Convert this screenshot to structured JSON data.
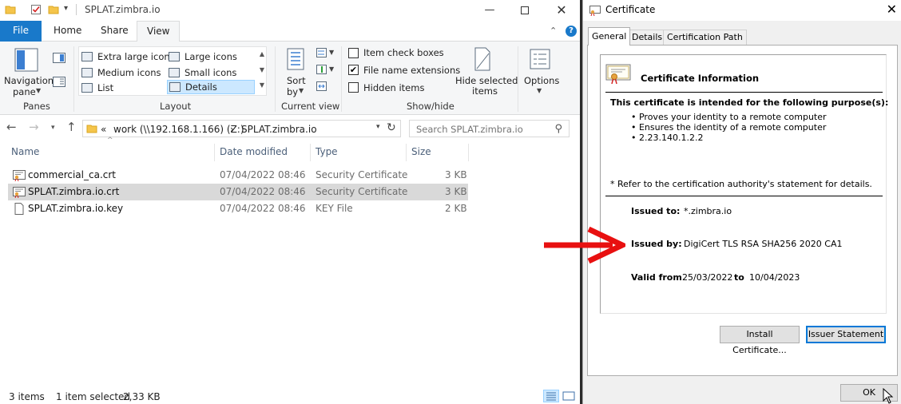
{
  "explorer": {
    "title": "SPLAT.zimbra.io",
    "tabs": {
      "file": "File",
      "home": "Home",
      "share": "Share",
      "view": "View"
    },
    "ribbon": {
      "panes": {
        "nav_pane": "Navigation",
        "nav_pane2": "pane",
        "group": "Panes"
      },
      "layout": {
        "items": [
          "Extra large icons",
          "Large icons",
          "Medium icons",
          "Small icons",
          "List",
          "Details"
        ],
        "selected": "Details",
        "group": "Layout"
      },
      "current_view": {
        "sort": "Sort",
        "sort2": "by",
        "group": "Current view"
      },
      "show_hide": {
        "item_check_boxes": "Item check boxes",
        "file_name_extensions": "File name extensions",
        "hidden_items": "Hidden items",
        "hide_selected": "Hide selected",
        "hide_selected2": "items",
        "group": "Show/hide"
      },
      "options": "Options"
    },
    "address": {
      "chevron": "«",
      "part1": "work (\\\\192.168.1.166) (Z:)",
      "sep": "›",
      "part2": "SPLAT.zimbra.io"
    },
    "search": {
      "placeholder": "Search SPLAT.zimbra.io"
    },
    "columns": {
      "name": "Name",
      "date": "Date modified",
      "type": "Type",
      "size": "Size"
    },
    "files": [
      {
        "name": "commercial_ca.crt",
        "date": "07/04/2022 08:46",
        "type": "Security Certificate",
        "size": "3 KB"
      },
      {
        "name": "SPLAT.zimbra.io.crt",
        "date": "07/04/2022 08:46",
        "type": "Security Certificate",
        "size": "3 KB"
      },
      {
        "name": "SPLAT.zimbra.io.key",
        "date": "07/04/2022 08:46",
        "type": "KEY File",
        "size": "2 KB"
      }
    ],
    "status": {
      "items": "3 items",
      "selected": "1 item selected",
      "size": "2,33 KB"
    }
  },
  "certificate": {
    "title": "Certificate",
    "tabs": {
      "general": "General",
      "details": "Details",
      "path": "Certification Path"
    },
    "info_heading": "Certificate Information",
    "purpose_heading": "This certificate is intended for the following purpose(s):",
    "purposes": [
      "• Proves your identity to a remote computer",
      "• Ensures the identity of a remote computer",
      "• 2.23.140.1.2.2"
    ],
    "note": "* Refer to the certification authority's statement for details.",
    "issued_to_label": "Issued to:",
    "issued_to": "*.zimbra.io",
    "issued_by_label": "Issued by:",
    "issued_by": "DigiCert TLS RSA SHA256 2020 CA1",
    "valid_from_label": "Valid from",
    "valid_from": "25/03/2022",
    "valid_to_label": "to",
    "valid_to": "10/04/2023",
    "install_button": "Install Certificate...",
    "issuer_button": "Issuer Statement",
    "ok_button": "OK"
  },
  "colors": {
    "file_tab": "#1979ca",
    "selection": "#cce8ff",
    "arrow": "#e81010"
  }
}
